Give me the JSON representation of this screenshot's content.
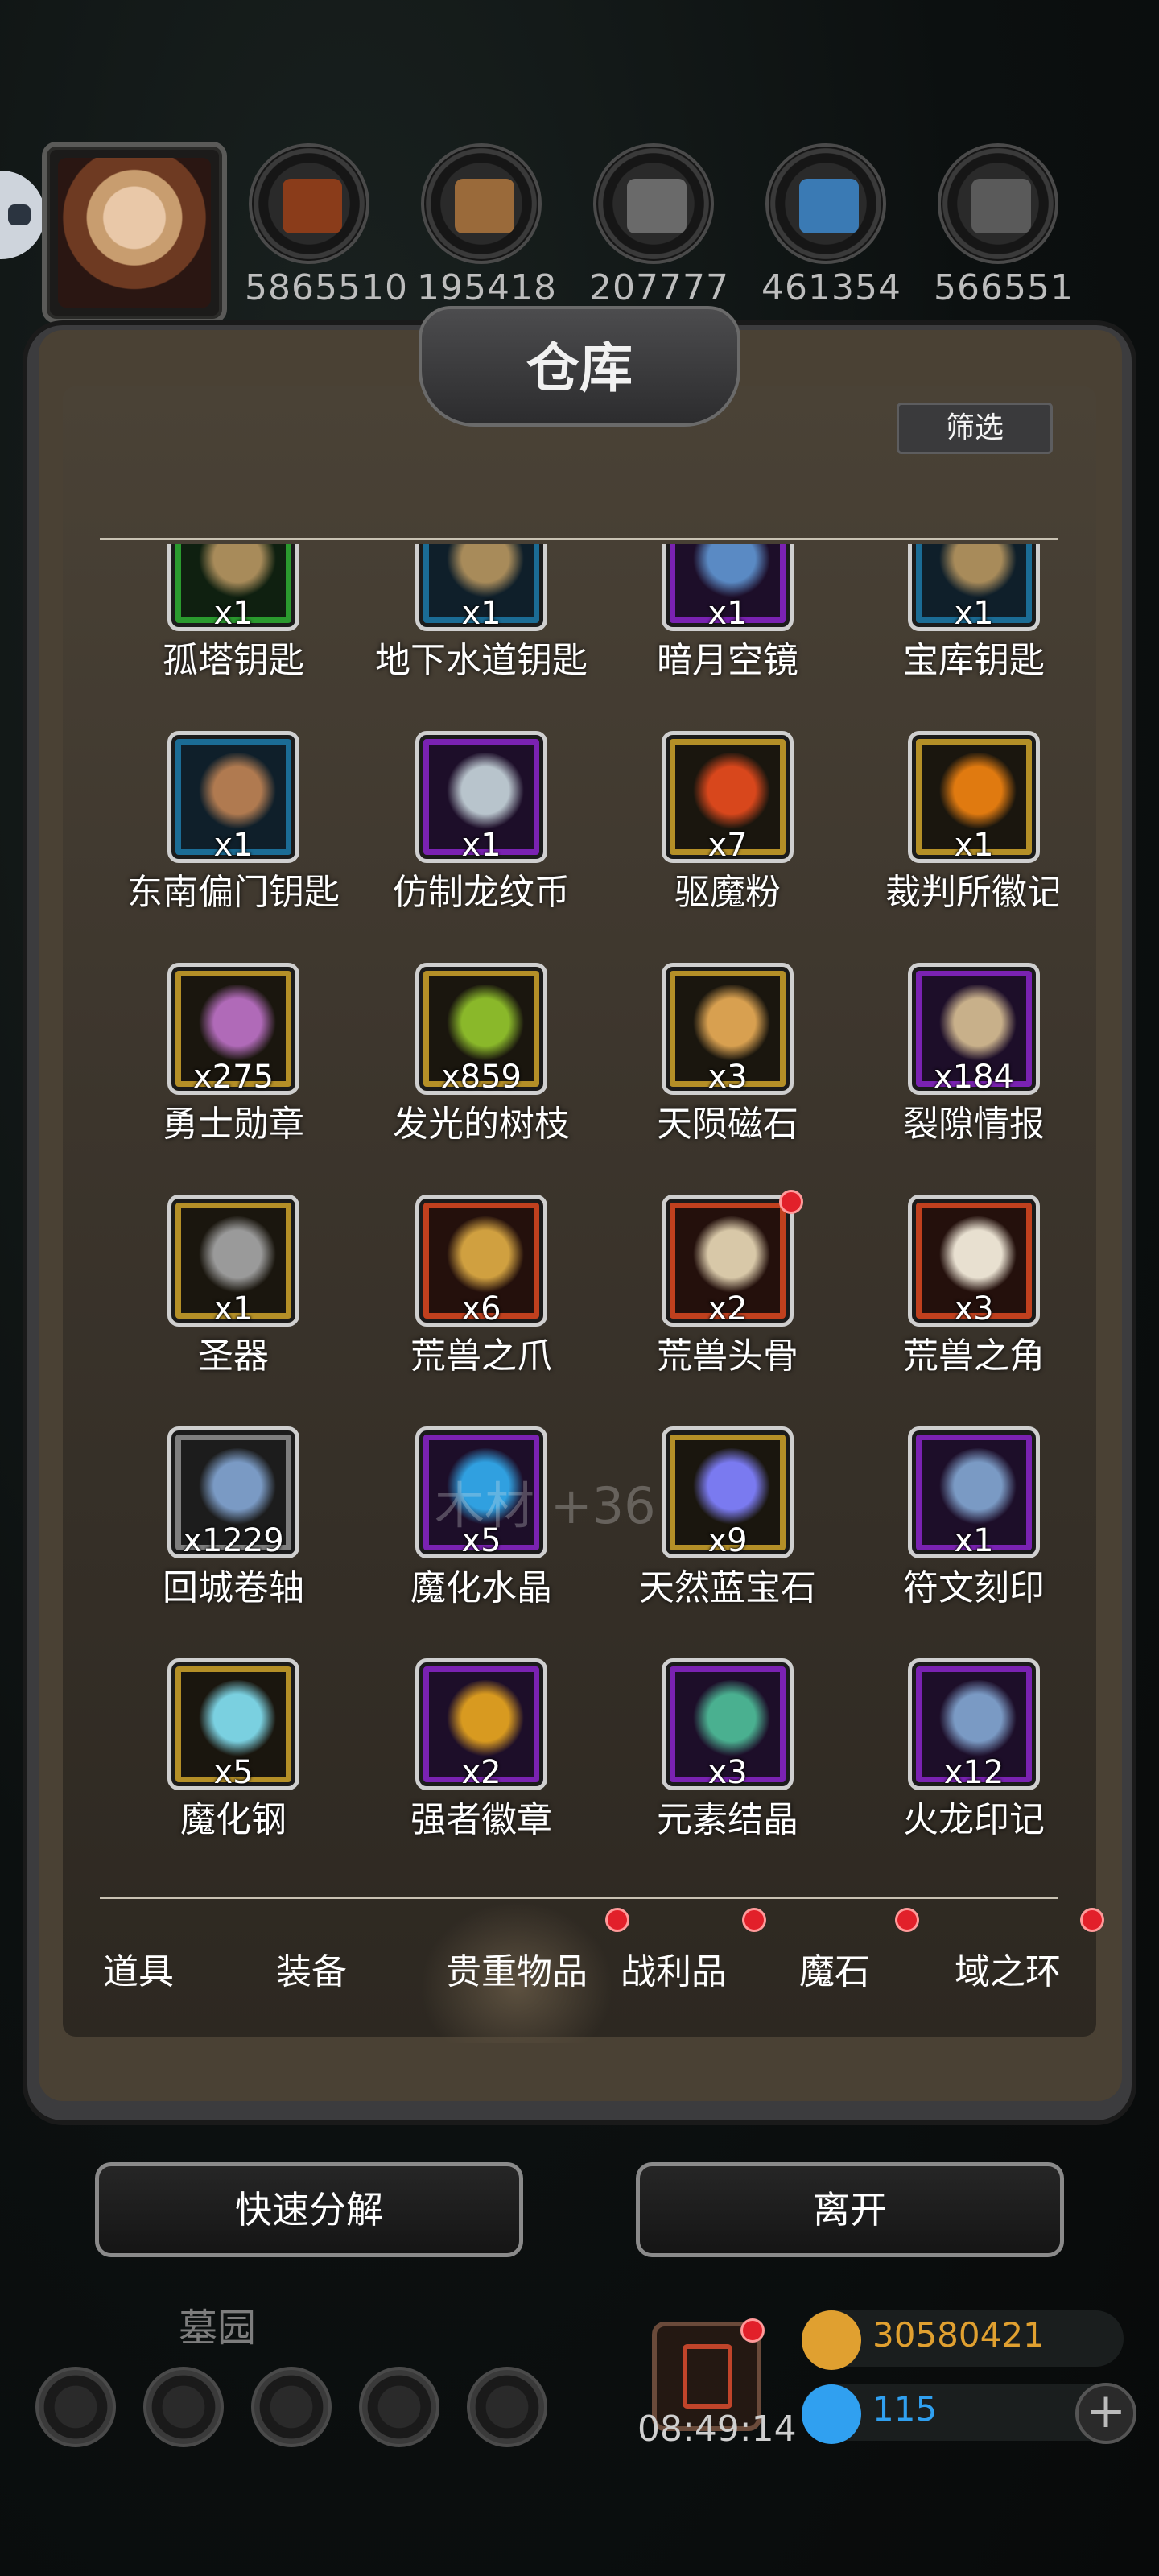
{
  "resources": [
    {
      "icon": "leather-icon",
      "value": "5865510",
      "color": "#8a3c1a"
    },
    {
      "icon": "wood-planks-icon",
      "value": "195418",
      "color": "#9a6a3a"
    },
    {
      "icon": "iron-ingot-icon",
      "value": "207777",
      "color": "#6a6a6a"
    },
    {
      "icon": "crystal-icon",
      "value": "461354",
      "color": "#3a7ab4"
    },
    {
      "icon": "steel-ingot-icon",
      "value": "566551",
      "color": "#5a5a5a"
    }
  ],
  "panel": {
    "title": "仓库",
    "filter_label": "筛选"
  },
  "items": [
    {
      "name": "孤塔钥匙",
      "qty": "x1",
      "rarity": "green",
      "icon": "key-icon",
      "color": "#a88b5a"
    },
    {
      "name": "地下水道钥匙",
      "qty": "x1",
      "rarity": "blue",
      "icon": "key-icon",
      "color": "#a88b5a"
    },
    {
      "name": "暗月空镜",
      "qty": "x1",
      "rarity": "purple",
      "icon": "mirror-icon",
      "color": "#5a8ac4"
    },
    {
      "name": "宝库钥匙",
      "qty": "x1",
      "rarity": "blue",
      "icon": "key-icon",
      "color": "#a88b5a"
    },
    {
      "name": "东南偏门钥匙",
      "qty": "x1",
      "rarity": "blue",
      "icon": "key-icon",
      "color": "#b07a50"
    },
    {
      "name": "仿制龙纹币",
      "qty": "x1",
      "rarity": "purple",
      "icon": "coin-icon",
      "color": "#b8c4cc"
    },
    {
      "name": "驱魔粉",
      "qty": "x7",
      "rarity": "gold",
      "icon": "powder-icon",
      "color": "#d8471c"
    },
    {
      "name": "裁判所徽记",
      "qty": "x1",
      "rarity": "gold",
      "icon": "emblem-icon",
      "color": "#e07a10"
    },
    {
      "name": "勇士勋章",
      "qty": "x275",
      "rarity": "gold",
      "icon": "medal-icon",
      "color": "#b06ab8"
    },
    {
      "name": "发光的树枝",
      "qty": "x859",
      "rarity": "gold",
      "icon": "branch-icon",
      "color": "#8ab82a"
    },
    {
      "name": "天陨磁石",
      "qty": "x3",
      "rarity": "gold",
      "icon": "rock-icon",
      "color": "#d8a050"
    },
    {
      "name": "裂隙情报",
      "qty": "x184",
      "rarity": "purple",
      "icon": "scroll-icon",
      "color": "#c8b08a"
    },
    {
      "name": "圣器",
      "qty": "x1",
      "rarity": "gold",
      "icon": "spear-icon",
      "color": "#9a9a9a"
    },
    {
      "name": "荒兽之爪",
      "qty": "x6",
      "rarity": "red",
      "icon": "claw-icon",
      "color": "#d0a040"
    },
    {
      "name": "荒兽头骨",
      "qty": "x2",
      "rarity": "red",
      "icon": "skull-icon",
      "color": "#d8c8a8",
      "badge": true
    },
    {
      "name": "荒兽之角",
      "qty": "x3",
      "rarity": "red",
      "icon": "horn-icon",
      "color": "#e8e0d0"
    },
    {
      "name": "回城卷轴",
      "qty": "x1229",
      "rarity": "gray",
      "icon": "portal-icon",
      "color": "#7a9ac4"
    },
    {
      "name": "魔化水晶",
      "qty": "x5",
      "rarity": "purple",
      "icon": "crystal-icon",
      "color": "#30a0e0"
    },
    {
      "name": "天然蓝宝石",
      "qty": "x9",
      "rarity": "gold",
      "icon": "sapphire-icon",
      "color": "#7a7af0"
    },
    {
      "name": "符文刻印",
      "qty": "x1",
      "rarity": "purple",
      "icon": "rune-icon",
      "color": "#7a9ac4"
    },
    {
      "name": "魔化钢",
      "qty": "x5",
      "rarity": "gold",
      "icon": "ingot-icon",
      "color": "#7ad0e0"
    },
    {
      "name": "强者徽章",
      "qty": "x2",
      "rarity": "purple",
      "icon": "badge-icon",
      "color": "#d89a20"
    },
    {
      "name": "元素结晶",
      "qty": "x3",
      "rarity": "purple",
      "icon": "shard-icon",
      "color": "#4ab090"
    },
    {
      "name": "火龙印记",
      "qty": "x12",
      "rarity": "purple",
      "icon": "rune-icon",
      "color": "#7a9ac4"
    },
    {
      "name": "",
      "qty": "",
      "rarity": "purple",
      "icon": "item-icon",
      "color": "#333"
    },
    {
      "name": "",
      "qty": "",
      "rarity": "purple",
      "icon": "item-icon",
      "color": "#333"
    },
    {
      "name": "",
      "qty": "",
      "rarity": "purple",
      "icon": "item-icon",
      "color": "#333"
    },
    {
      "name": "",
      "qty": "",
      "rarity": "blue",
      "icon": "item-icon",
      "color": "#333"
    }
  ],
  "watermark": "木材 +36",
  "tabs": [
    {
      "label": "道具",
      "dot": false,
      "active": false
    },
    {
      "label": "装备",
      "dot": false,
      "active": false
    },
    {
      "label": "贵重物品",
      "dot": true,
      "active": true
    },
    {
      "label": "战利品",
      "dot": true,
      "active": false
    },
    {
      "label": "魔石",
      "dot": true,
      "active": false
    },
    {
      "label": "域之环",
      "dot": true,
      "active": false
    }
  ],
  "buttons": {
    "decompose": "快速分解",
    "leave": "离开"
  },
  "hud": {
    "location": "墓园",
    "timer": "08:49:14",
    "gold": "30580421",
    "gems": "115",
    "gold_color": "#e0a030",
    "gem_color": "#30a0f0"
  }
}
